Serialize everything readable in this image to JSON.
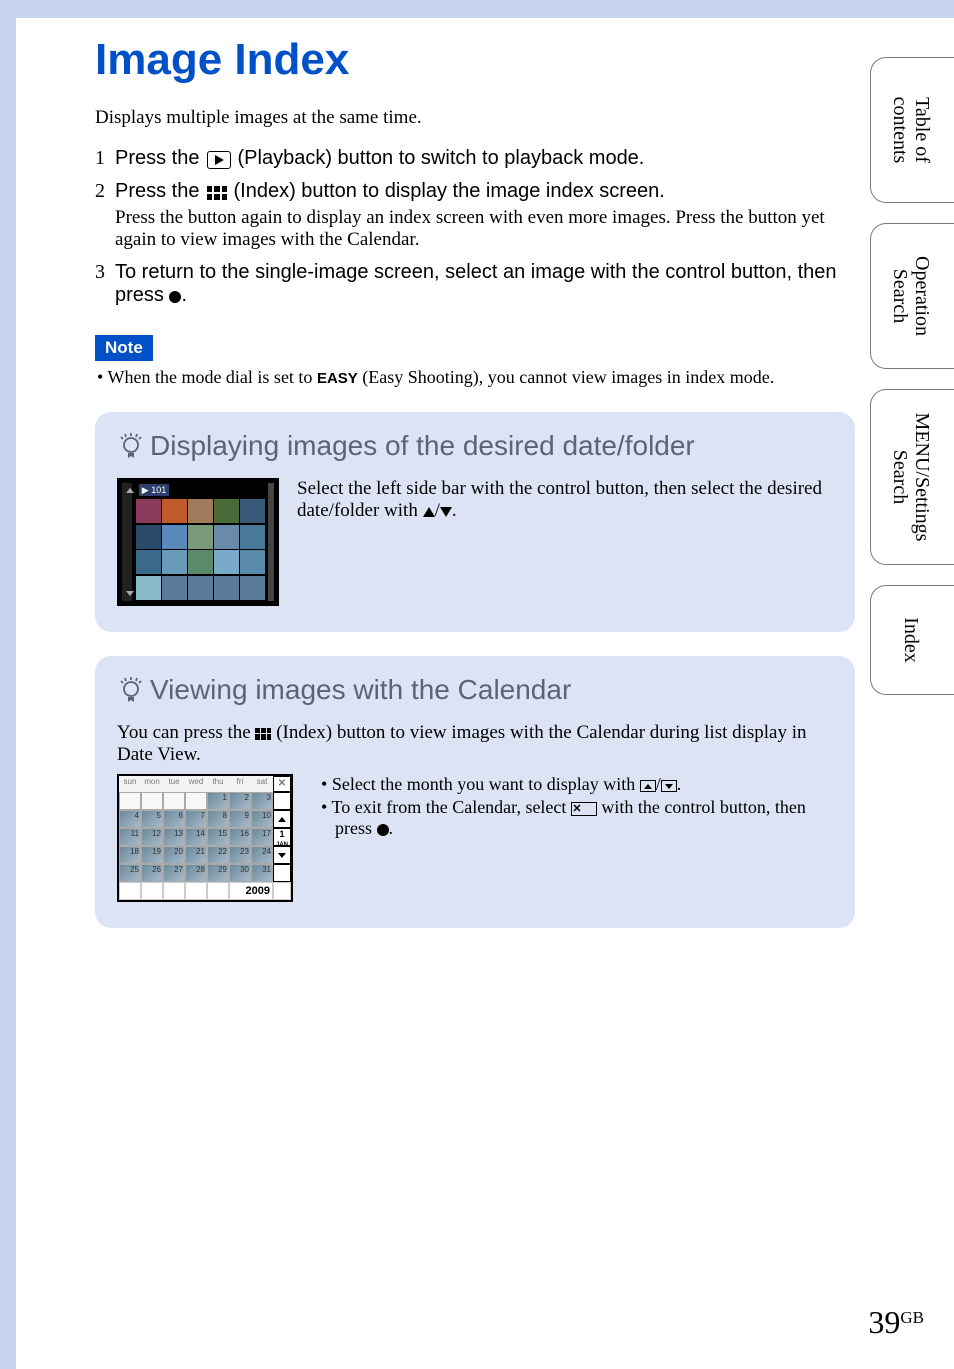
{
  "page": {
    "title": "Image Index",
    "intro": "Displays multiple images at the same time.",
    "number": "39",
    "region": "GB"
  },
  "steps": {
    "s1_num": "1",
    "s1_a": "Press the ",
    "s1_b": " (Playback) button to switch to playback mode.",
    "s2_num": "2",
    "s2_a": "Press the ",
    "s2_b": " (Index) button to display the image index screen.",
    "s2_note": "Press the button again to display an index screen with even more images. Press the button yet again to view images with the Calendar.",
    "s3_num": "3",
    "s3_a": "To return to the single-image screen, select an image with the control button, then press ",
    "s3_b": "."
  },
  "note": {
    "label": "Note",
    "bullet_a": "• When the mode dial is set to ",
    "bullet_easy": "EASY",
    "bullet_b": " (Easy Shooting), you cannot view images in index mode."
  },
  "tip1": {
    "title": "Displaying images of the desired date/folder",
    "text_a": "Select the left side bar with the control button, then select the desired date/folder with ",
    "text_b": "/",
    "text_c": ".",
    "thumb_folder": "101"
  },
  "tip2": {
    "title": "Viewing images with the Calendar",
    "intro_a": "You can press the ",
    "intro_b": " (Index) button to view images with the Calendar during list display in Date View.",
    "b1_a": "Select the month you want to display with ",
    "b1_b": "/",
    "b1_c": ".",
    "b2_a": "To exit from the Calendar, select ",
    "b2_x": "✕",
    "b2_b": " with the control button, then press ",
    "b2_c": "."
  },
  "calendar": {
    "days": [
      "sun",
      "mon",
      "tue",
      "wed",
      "thu",
      "fri",
      "sat"
    ],
    "month_num": "1",
    "month_label": "JAN",
    "year": "2009",
    "close": "✕"
  },
  "tabs": {
    "t1a": "Table of",
    "t1b": "contents",
    "t2a": "Operation",
    "t2b": "Search",
    "t3a": "MENU/Settings",
    "t3b": "Search",
    "t4": "Index"
  }
}
